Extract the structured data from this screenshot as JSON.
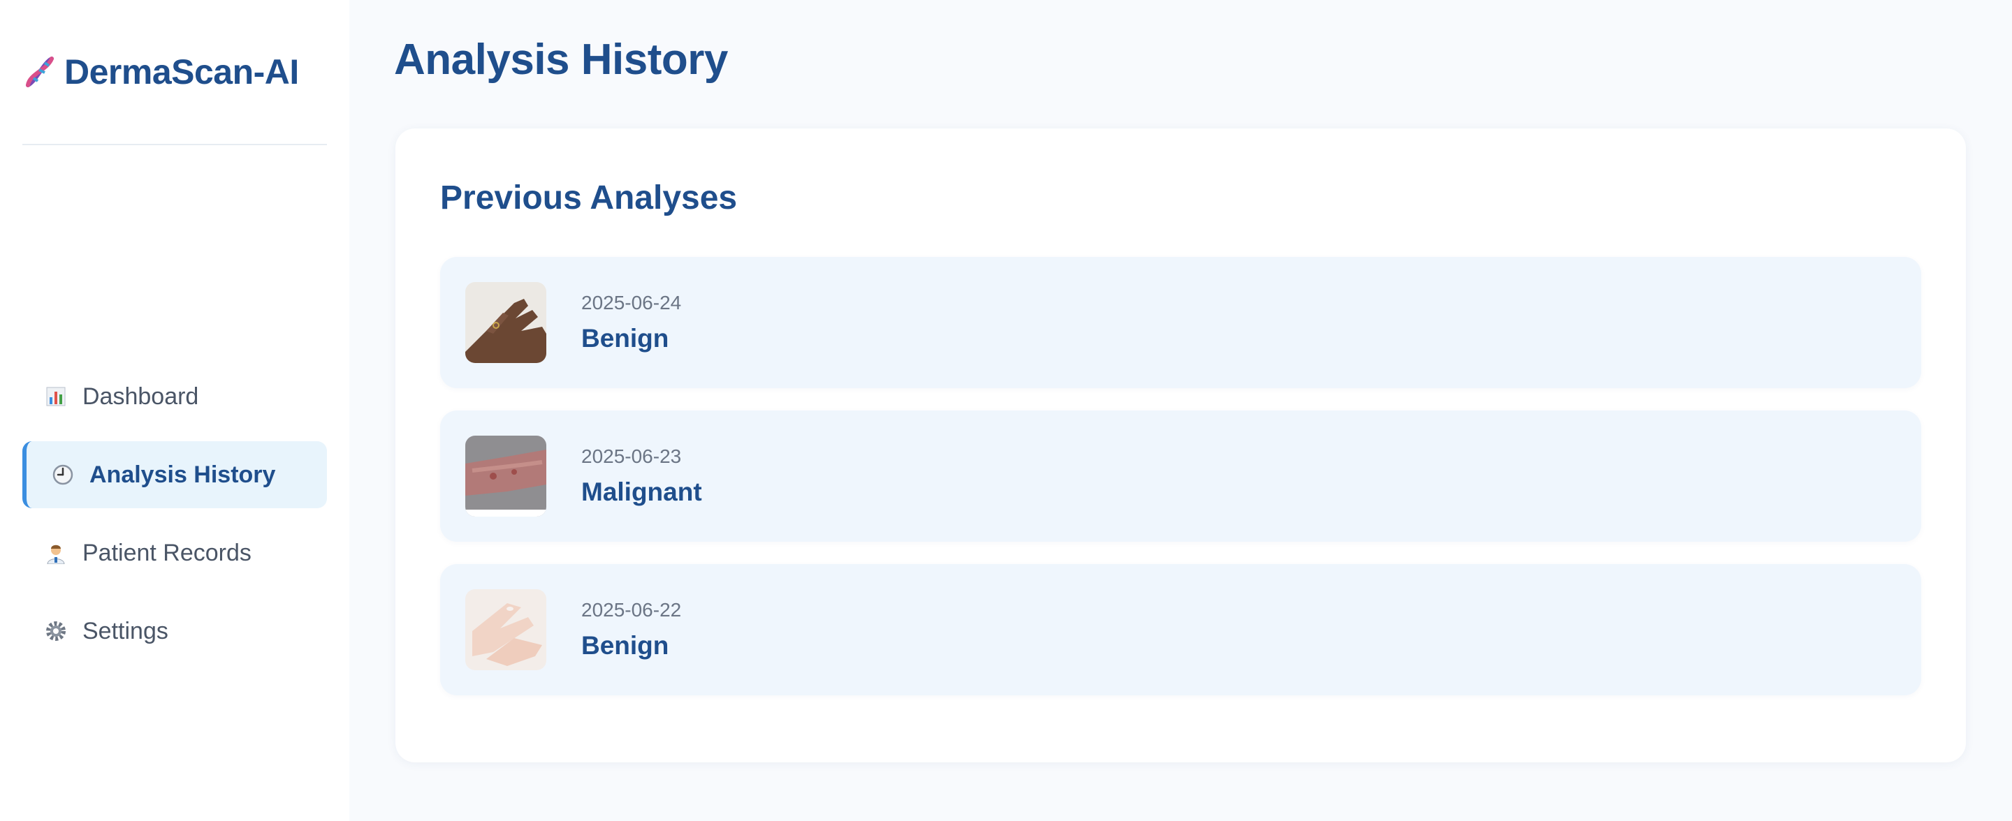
{
  "brand": {
    "name": "DermaScan-AI",
    "icon": "dna-icon"
  },
  "nav": {
    "items": [
      {
        "label": "Dashboard",
        "icon": "bar-chart-icon",
        "active": false
      },
      {
        "label": "Analysis History",
        "icon": "clock-icon",
        "active": true
      },
      {
        "label": "Patient Records",
        "icon": "doctor-icon",
        "active": false
      },
      {
        "label": "Settings",
        "icon": "gear-icon",
        "active": false
      }
    ]
  },
  "page": {
    "title": "Analysis History"
  },
  "history": {
    "title": "Previous Analyses",
    "items": [
      {
        "date": "2025-06-24",
        "result": "Benign"
      },
      {
        "date": "2025-06-23",
        "result": "Malignant"
      },
      {
        "date": "2025-06-22",
        "result": "Benign"
      }
    ]
  },
  "colors": {
    "accent": "#1f4e8c",
    "active_bg": "#e8f4fc",
    "active_border": "#3b8ee0",
    "item_bg": "#eff6fd",
    "page_bg": "#f8fafd"
  }
}
